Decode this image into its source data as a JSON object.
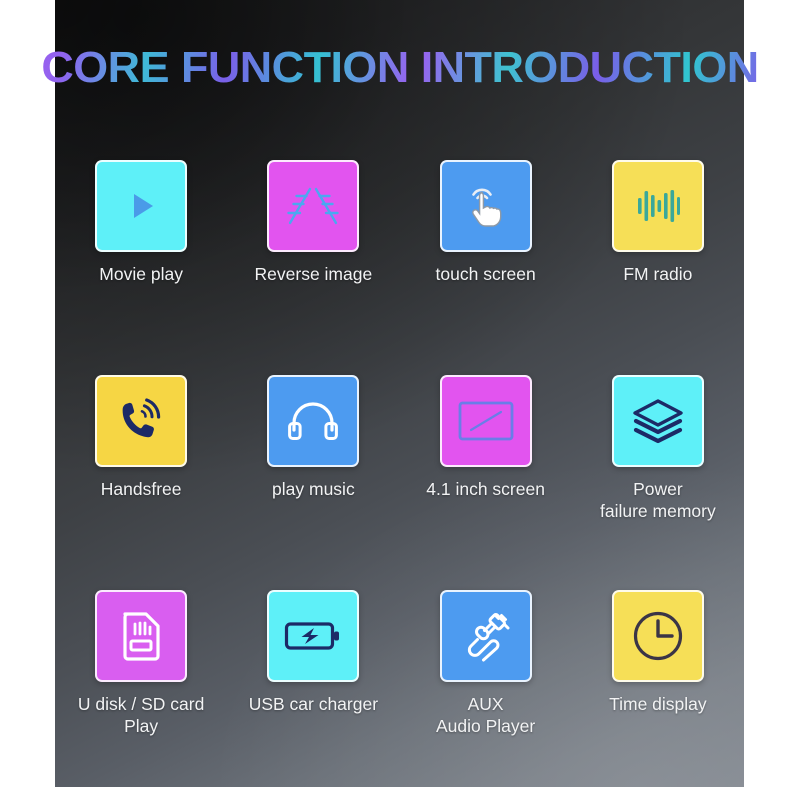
{
  "header": {
    "title": "CORE FUNCTION INTRODUCTION",
    "title_gradient_from": "#b05cf0",
    "title_gradient_to": "#2fc8ce"
  },
  "panel": {
    "background_top": "#272829",
    "background_bottom": "#80868e"
  },
  "features": [
    {
      "label": "Movie play",
      "icon": "play-icon",
      "tile_color": "#5ef0f8",
      "icon_color": "#4a9be8"
    },
    {
      "label": "Reverse image",
      "icon": "reverse-parking-lines-icon",
      "tile_color": "#e254ef",
      "icon_color": "#4aa8f0"
    },
    {
      "label": "touch screen",
      "icon": "touch-hand-icon",
      "tile_color": "#4d9bf0",
      "icon_color": "#ffffff"
    },
    {
      "label": "FM radio",
      "icon": "sound-wave-icon",
      "tile_color": "#f6df57",
      "icon_color": "#3aa89a"
    },
    {
      "label": "Handsfree",
      "icon": "phone-call-icon",
      "tile_color": "#f6d githubusercontent",
      "icon_color": "#1c2a66"
    },
    {
      "label": "play music",
      "icon": "headphones-icon",
      "tile_color": "#4d9bf0",
      "icon_color": "#ffffff"
    },
    {
      "label": "4.1 inch screen",
      "icon": "screen-icon",
      "tile_color": "#e254ef",
      "icon_color": "#6a7de8"
    },
    {
      "label": "Power\nfailure memory",
      "icon": "layers-stack-icon",
      "tile_color": "#5ef0f8",
      "icon_color": "#1c2a66"
    },
    {
      "label": "U disk / SD card\nPlay",
      "icon": "sd-card-icon",
      "tile_color": "#d95ef0",
      "icon_color": "#ffffff"
    },
    {
      "label": "USB car charger",
      "icon": "battery-charging-icon",
      "tile_color": "#5ef0f8",
      "icon_color": "#1c2a66"
    },
    {
      "label": "AUX\nAudio Player",
      "icon": "aux-plug-icon",
      "tile_color": "#4d9bf0",
      "icon_color": "#ffffff"
    },
    {
      "label": "Time display",
      "icon": "clock-icon",
      "tile_color": "#f6df57",
      "icon_color": "#3b3546"
    }
  ]
}
